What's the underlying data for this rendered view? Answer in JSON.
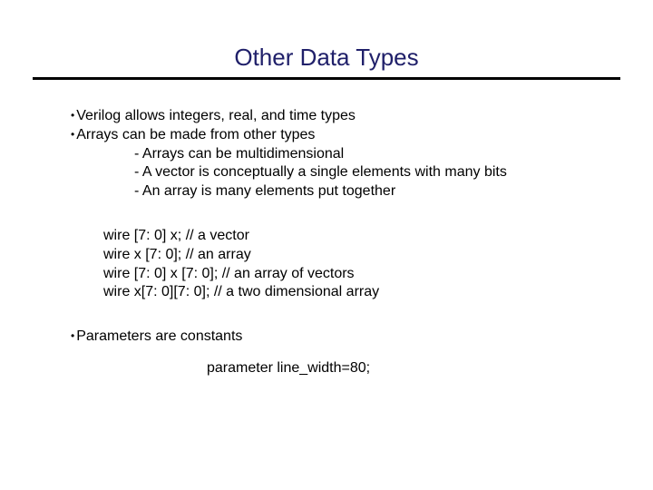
{
  "title": "Other Data Types",
  "bullets": {
    "b1": "Verilog allows integers, real, and time types",
    "b2": "Arrays can be made from other types",
    "s1": "- Arrays can be multidimensional",
    "s2": "- A vector is conceptually a single elements with many bits",
    "s3": "- An array is many elements put together"
  },
  "code": {
    "c1": "wire [7: 0] x; // a vector",
    "c2": "wire x [7: 0]; // an array",
    "c3": "wire [7: 0] x [7: 0]; // an array of vectors",
    "c4": "wire x[7: 0][7: 0]; // a two dimensional array"
  },
  "bullets2": {
    "b3": "Parameters are constants"
  },
  "param": "parameter line_width=80;"
}
